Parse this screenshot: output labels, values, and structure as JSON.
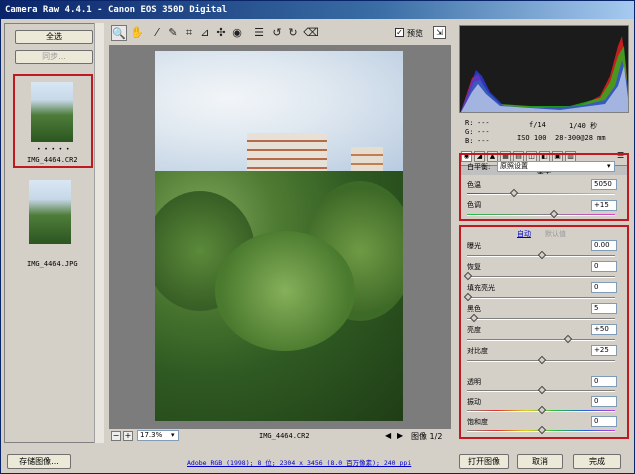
{
  "title": "Camera Raw 4.4.1 -  Canon EOS 350D Digital",
  "left": {
    "select_all_label": "全选",
    "sync_label": "同步...",
    "files": [
      {
        "name": "IMG_4464.CR2",
        "dots": "• • • • •"
      },
      {
        "name": "IMG_4464.JPG"
      }
    ]
  },
  "toolbar": {
    "preview_label": "预览",
    "tools": [
      "zoom-icon",
      "hand-icon",
      "white-balance-icon",
      "color-sampler-icon",
      "crop-icon",
      "straighten-icon",
      "spot-removal-icon",
      "red-eye-icon",
      "preferences-icon",
      "rotate-left-icon",
      "rotate-right-icon",
      "trash-icon"
    ],
    "tool_glyphs": [
      "🔍",
      "✋",
      "⁄",
      "✎",
      "⌗",
      "⊿",
      "✣",
      "◉",
      "☰",
      "↺",
      "↻",
      "🗑"
    ]
  },
  "bottom": {
    "zoom_value": "17.3%",
    "filename": "IMG_4464.CR2",
    "page_label": "图像 1/2"
  },
  "info": {
    "r_label": "R:",
    "r_value": "---",
    "g_label": "G:",
    "g_value": "---",
    "b_label": "B:",
    "b_value": "---",
    "aperture": "f/14",
    "shutter": "1/40 秒",
    "iso": "ISO 100",
    "lens": "28-300@28 mm"
  },
  "panel": {
    "title": "基本",
    "wb_label": "白平衡:",
    "wb_value": "原照设置",
    "temp_label": "色温",
    "temp_value": "5050",
    "tint_label": "色调",
    "tint_value": "+15",
    "auto_label": "自动",
    "default_label": "默认值",
    "exposure_label": "曝光",
    "exposure_value": "0.00",
    "recovery_label": "恢复",
    "recovery_value": "0",
    "fill_label": "填充亮光",
    "fill_value": "0",
    "blacks_label": "黑色",
    "blacks_value": "5",
    "brightness_label": "亮度",
    "brightness_value": "+50",
    "contrast_label": "对比度",
    "contrast_value": "+25",
    "clarity_label": "透明",
    "clarity_value": "0",
    "vibrance_label": "振动",
    "vibrance_value": "0",
    "saturation_label": "饱和度",
    "saturation_value": "0"
  },
  "footer": {
    "save_label": "存储图像...",
    "workflow_link": "Adobe RGB (1998); 8 位; 2304 x 3456 (8.0 百万像素); 240 ppi",
    "open_label": "打开图像",
    "cancel_label": "取消",
    "done_label": "完成"
  },
  "colors": {
    "highlight_red": "#c0191f",
    "title_blue": "#0a246a",
    "preview_gray": "#7c7c7c",
    "link_blue": "#0000cc"
  }
}
